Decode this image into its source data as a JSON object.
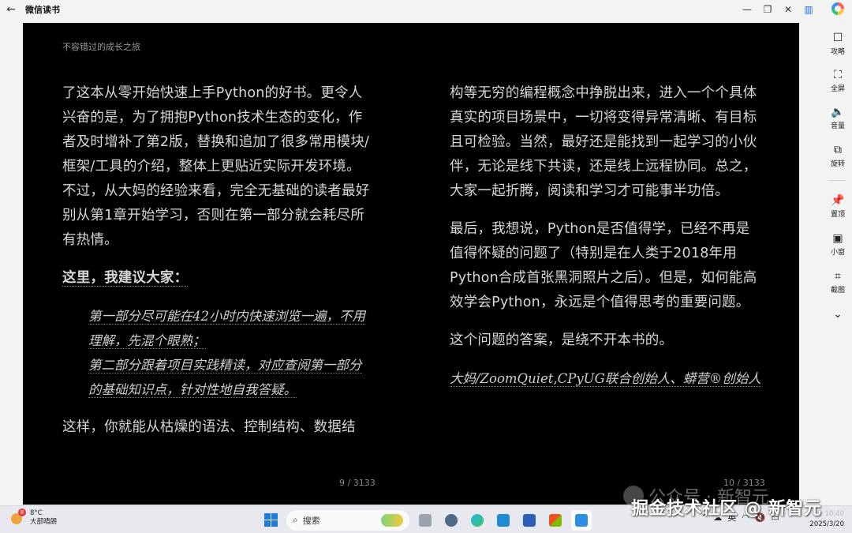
{
  "window": {
    "title": "微信读书",
    "back_icon": "←",
    "minimize_icon": "—",
    "restore_icon": "❐",
    "close_icon": "✕",
    "panel_icon": "▥"
  },
  "reader": {
    "book_title": "不容错过的成长之旅",
    "left_page": {
      "p1": "了这本从零开始快速上手Python的好书。更令人兴奋的是，为了拥抱Python技术生态的变化，作者及时增补了第2版，替换和追加了很多常用模块/框架/工具的介绍，整体上更贴近实际开发环境。不过，从大妈的经验来看，完全无基础的读者最好别从第1章开始学习，否则在第一部分就会耗尽所有热情。",
      "p2": "这里，我建议大家：",
      "q1": "第一部分尽可能在42小时内快速浏览一遍，不用理解，先混个眼熟；",
      "q2": "第二部分跟着项目实践精读，对应查阅第一部分的基础知识点，针对性地自我答疑。",
      "p3": "这样，你就能从枯燥的语法、控制结构、数据结",
      "page_number": "9 / 3133"
    },
    "right_page": {
      "p1": "构等无穷的编程概念中挣脱出来，进入一个个具体真实的项目场景中，一切将变得异常清晰、有目标且可检验。当然，最好还是能找到一起学习的小伙伴，无论是线下共读，还是线上远程协同。总之，大家一起折腾，阅读和学习才可能事半功倍。",
      "p2": "最后，我想说，Python是否值得学，已经不再是值得怀疑的问题了（特别是在人类于2018年用Python合成首张黑洞照片之后）。但是，如何能高效学会Python，永远是个值得思考的重要问题。",
      "p3": "这个问题的答案，是绕不开本书的。",
      "sign": "大妈/ZoomQuiet,CPyUG联合创始人、蟒营®创始人",
      "page_number": "10 / 3133"
    }
  },
  "sidebar": {
    "items": [
      {
        "icon": "☐",
        "label": "攻略"
      },
      {
        "icon": "⛶",
        "label": "全屏"
      },
      {
        "icon": "🔈",
        "label": "音量"
      },
      {
        "icon": "⧉",
        "label": "旋转"
      },
      {
        "icon": "📌",
        "label": "置顶"
      },
      {
        "icon": "▣",
        "label": "小窗"
      },
      {
        "icon": "⌗",
        "label": "截图"
      }
    ],
    "more_icon": "⌄"
  },
  "taskbar": {
    "temperature": "8°C",
    "weather": "大部晴朗",
    "weather_badge": "8",
    "search_placeholder": "搜索",
    "tray_lang": "英",
    "time": "10:40",
    "date": "2025/3/20"
  },
  "watermark": {
    "account": "公众号 · 新智元",
    "overlay": "掘金技术社区 @ 新智元"
  },
  "colors": {
    "reader_bg": "#000000",
    "text": "#d7d7d7",
    "accent": "#1a6fe0"
  }
}
